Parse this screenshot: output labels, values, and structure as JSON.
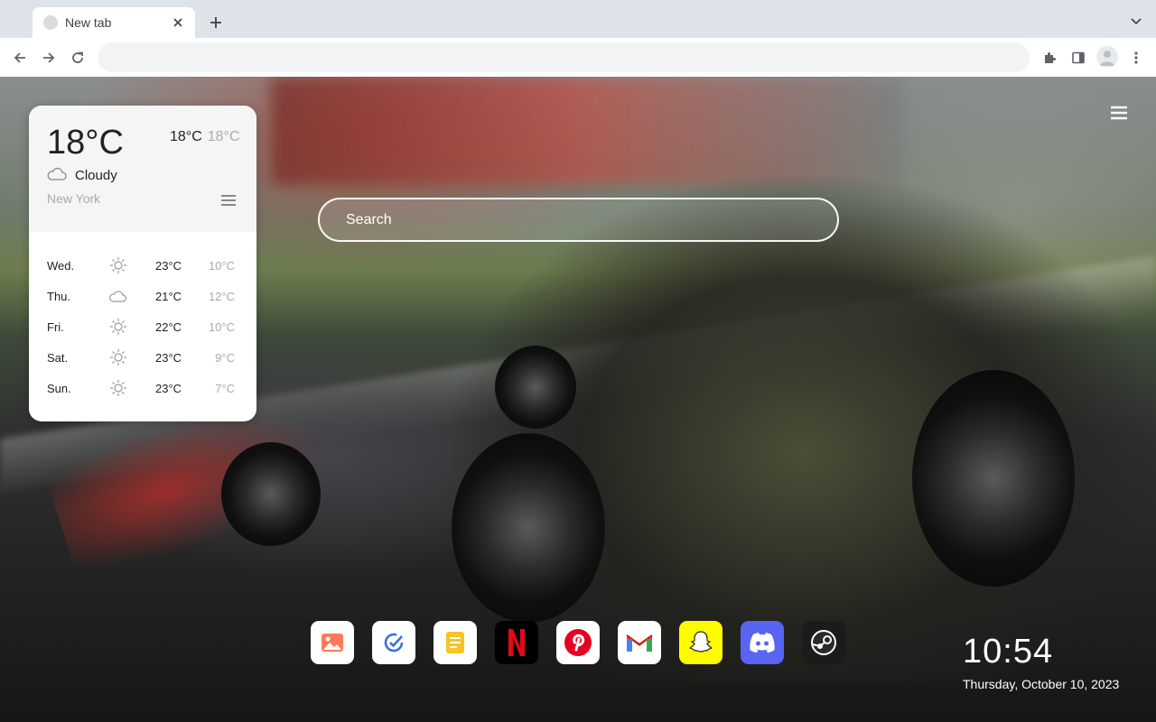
{
  "tab": {
    "title": "New tab"
  },
  "omnibox": {
    "value": "",
    "placeholder": ""
  },
  "weather": {
    "current_temp": "18°C",
    "high": "18°C",
    "low": "18°C",
    "condition": "Cloudy",
    "condition_icon": "cloud-icon",
    "city": "New York",
    "forecast": [
      {
        "day": "Wed.",
        "icon": "sun-icon",
        "high": "23°C",
        "low": "10°C"
      },
      {
        "day": "Thu.",
        "icon": "cloud-icon",
        "high": "21°C",
        "low": "12°C"
      },
      {
        "day": "Fri.",
        "icon": "sun-icon",
        "high": "22°C",
        "low": "10°C"
      },
      {
        "day": "Sat.",
        "icon": "sun-icon",
        "high": "23°C",
        "low": "9°C"
      },
      {
        "day": "Sun.",
        "icon": "sun-icon",
        "high": "23°C",
        "low": "7°C"
      }
    ]
  },
  "search": {
    "placeholder": "Search"
  },
  "dock": [
    {
      "name": "gallery-app",
      "color": "#ffffff"
    },
    {
      "name": "tasks-app",
      "color": "#ffffff"
    },
    {
      "name": "notes-app",
      "color": "#ffffff"
    },
    {
      "name": "netflix-app",
      "color": "#000000"
    },
    {
      "name": "pinterest-app",
      "color": "#ffffff"
    },
    {
      "name": "gmail-app",
      "color": "#ffffff"
    },
    {
      "name": "snapchat-app",
      "color": "#fffc00"
    },
    {
      "name": "discord-app",
      "color": "#5865f2"
    },
    {
      "name": "steam-app",
      "color": "#1b1b1b"
    }
  ],
  "clock": {
    "time": "10:54",
    "date": "Thursday, October 10, 2023"
  }
}
